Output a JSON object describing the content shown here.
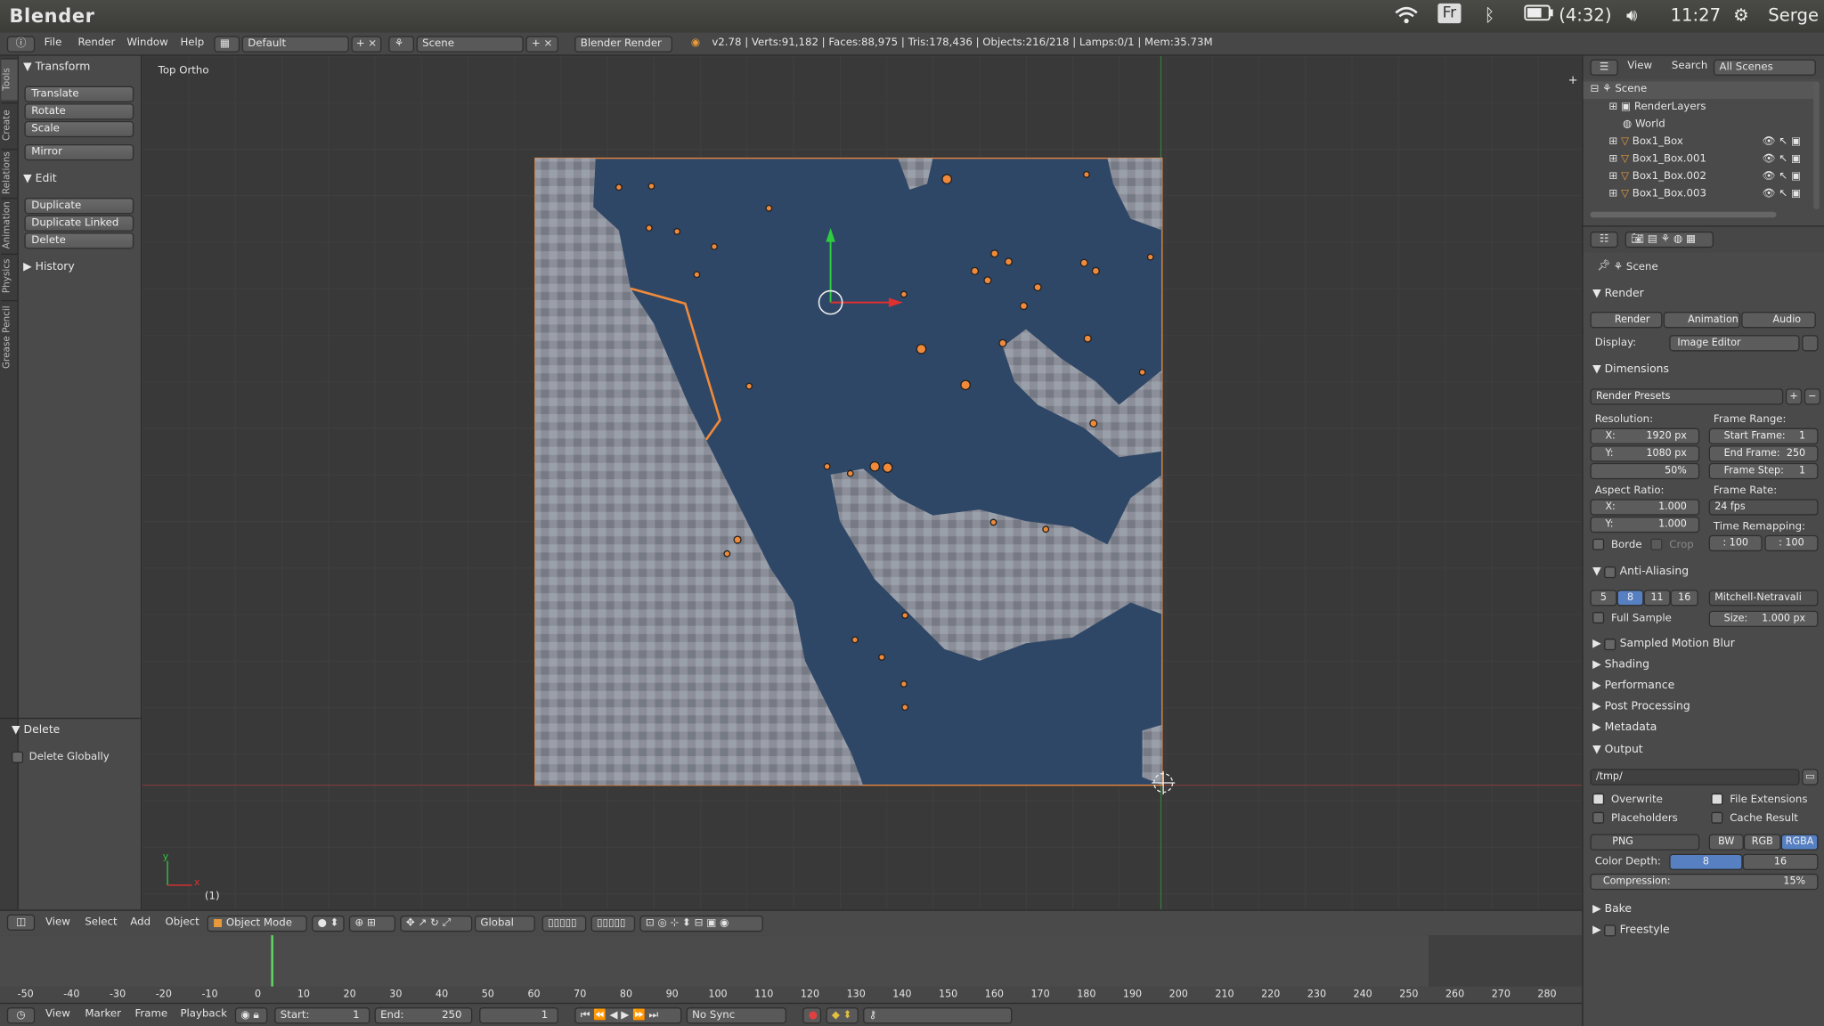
{
  "os": {
    "app_name": "Blender",
    "battery": "(4:32)",
    "time": "11:27",
    "user": "Serge",
    "keyboard": "Fr"
  },
  "info_header": {
    "menus": [
      "File",
      "Render",
      "Window",
      "Help"
    ],
    "screen": "Default",
    "scene": "Scene",
    "engine": "Blender Render",
    "stats": "v2.78 | Verts:91,182 | Faces:88,975 | Tris:178,436 | Objects:216/218 | Lamps:0/1 | Mem:35.73M"
  },
  "shelf": {
    "tabs": [
      "Tools",
      "Create",
      "Relations",
      "Animation",
      "Physics",
      "Grease Pencil"
    ],
    "transform_title": "Transform",
    "transform_buttons": [
      "Translate",
      "Rotate",
      "Scale"
    ],
    "mirror": "Mirror",
    "edit_title": "Edit",
    "edit_buttons": [
      "Duplicate",
      "Duplicate Linked",
      "Delete"
    ],
    "history": "History",
    "delete_panel": "Delete",
    "delete_globally": "Delete Globally"
  },
  "viewport": {
    "view_label": "Top Ortho",
    "frame_label": "(1)",
    "axis_x": "x",
    "axis_y": "y"
  },
  "view3d_header": {
    "menus": [
      "View",
      "Select",
      "Add",
      "Object"
    ],
    "mode": "Object Mode",
    "orientation": "Global"
  },
  "timeline": {
    "ticks": [
      "-50",
      "-40",
      "-30",
      "-20",
      "-10",
      "0",
      "10",
      "20",
      "30",
      "40",
      "50",
      "60",
      "70",
      "80",
      "90",
      "100",
      "110",
      "120",
      "130",
      "140",
      "150",
      "160",
      "170",
      "180",
      "190",
      "200",
      "210",
      "220",
      "230",
      "240",
      "250",
      "260",
      "270",
      "280"
    ],
    "menus": [
      "View",
      "Marker",
      "Frame",
      "Playback"
    ],
    "start_label": "Start:",
    "start": "1",
    "end_label": "End:",
    "end": "250",
    "current": "1",
    "sync": "No Sync"
  },
  "outliner": {
    "menus": [
      "View",
      "Search"
    ],
    "filter": "All Scenes",
    "items": [
      "Scene",
      "RenderLayers",
      "World",
      "Box1_Box",
      "Box1_Box.001",
      "Box1_Box.002",
      "Box1_Box.003"
    ]
  },
  "properties": {
    "context": "Scene",
    "render_title": "Render",
    "render_buttons": [
      "Render",
      "Animation",
      "Audio"
    ],
    "display_label": "Display:",
    "display_value": "Image Editor",
    "dimensions_title": "Dimensions",
    "presets": "Render Presets",
    "resolution_label": "Resolution:",
    "res_x_label": "X:",
    "res_x": "1920 px",
    "res_y_label": "Y:",
    "res_y": "1080 px",
    "res_pct": "50%",
    "frame_range_label": "Frame Range:",
    "start_frame_label": "Start Frame:",
    "start_frame": "1",
    "end_frame_label": "End Frame:",
    "end_frame": "250",
    "frame_step_label": "Frame Step:",
    "frame_step": "1",
    "aspect_label": "Aspect Ratio:",
    "aspect_x_label": "X:",
    "aspect_x": "1.000",
    "aspect_y_label": "Y:",
    "aspect_y": "1.000",
    "frame_rate_label": "Frame Rate:",
    "frame_rate": "24 fps",
    "time_remap_label": "Time Remapping:",
    "remap_old": ": 100",
    "remap_new": ": 100",
    "border": "Borde",
    "crop": "Crop",
    "aa_title": "Anti-Aliasing",
    "aa_samples": [
      "5",
      "8",
      "11",
      "16"
    ],
    "aa_filter": "Mitchell-Netravali",
    "full_sample": "Full Sample",
    "size_label": "Size:",
    "size": "1.000 px",
    "collapsed": [
      "Sampled Motion Blur",
      "Shading",
      "Performance",
      "Post Processing",
      "Metadata"
    ],
    "output_title": "Output",
    "output_path": "/tmp/",
    "overwrite": "Overwrite",
    "file_ext": "File Extensions",
    "placeholders": "Placeholders",
    "cache_result": "Cache Result",
    "format": "PNG",
    "color_modes": [
      "BW",
      "RGB",
      "RGBA"
    ],
    "color_depth_label": "Color Depth:",
    "depth_8": "8",
    "depth_16": "16",
    "compression_label": "Compression:",
    "compression": "15%",
    "bake": "Bake",
    "freestyle": "Freestyle"
  },
  "colors": {
    "accent": "#5680c2",
    "selected": "#f08a3a",
    "water": "#2f4766"
  }
}
